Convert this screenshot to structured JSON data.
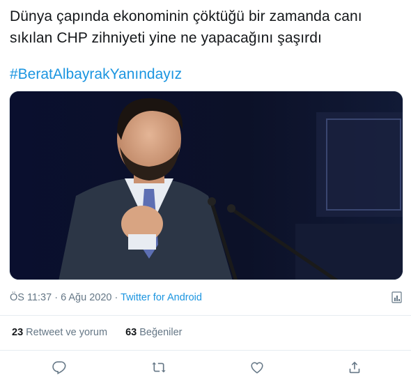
{
  "tweet": {
    "text_lines": [
      "Dünya çapında ekonominin çöktüğü bir zamanda canı",
      "sıkılan CHP zihniyeti yine ne yapacağını şaşırdı"
    ],
    "hashtag": "#BeratAlbayrakYanındayız",
    "timestamp": "ÖS 11:37 · 6 Ağu 2020",
    "separator": " · ",
    "source": "Twitter for Android"
  },
  "stats": {
    "retweets_count": "23",
    "retweets_label": "Retweet ve yorum",
    "likes_count": "63",
    "likes_label": "Beğeniler"
  },
  "icons": {
    "reply": "reply-icon",
    "retweet": "retweet-icon",
    "like": "heart-icon",
    "share": "share-icon",
    "info": "analytics-icon"
  },
  "colors": {
    "link": "#1b95e0",
    "text": "#14171a",
    "muted": "#657786",
    "divider": "#e6ecf0"
  }
}
